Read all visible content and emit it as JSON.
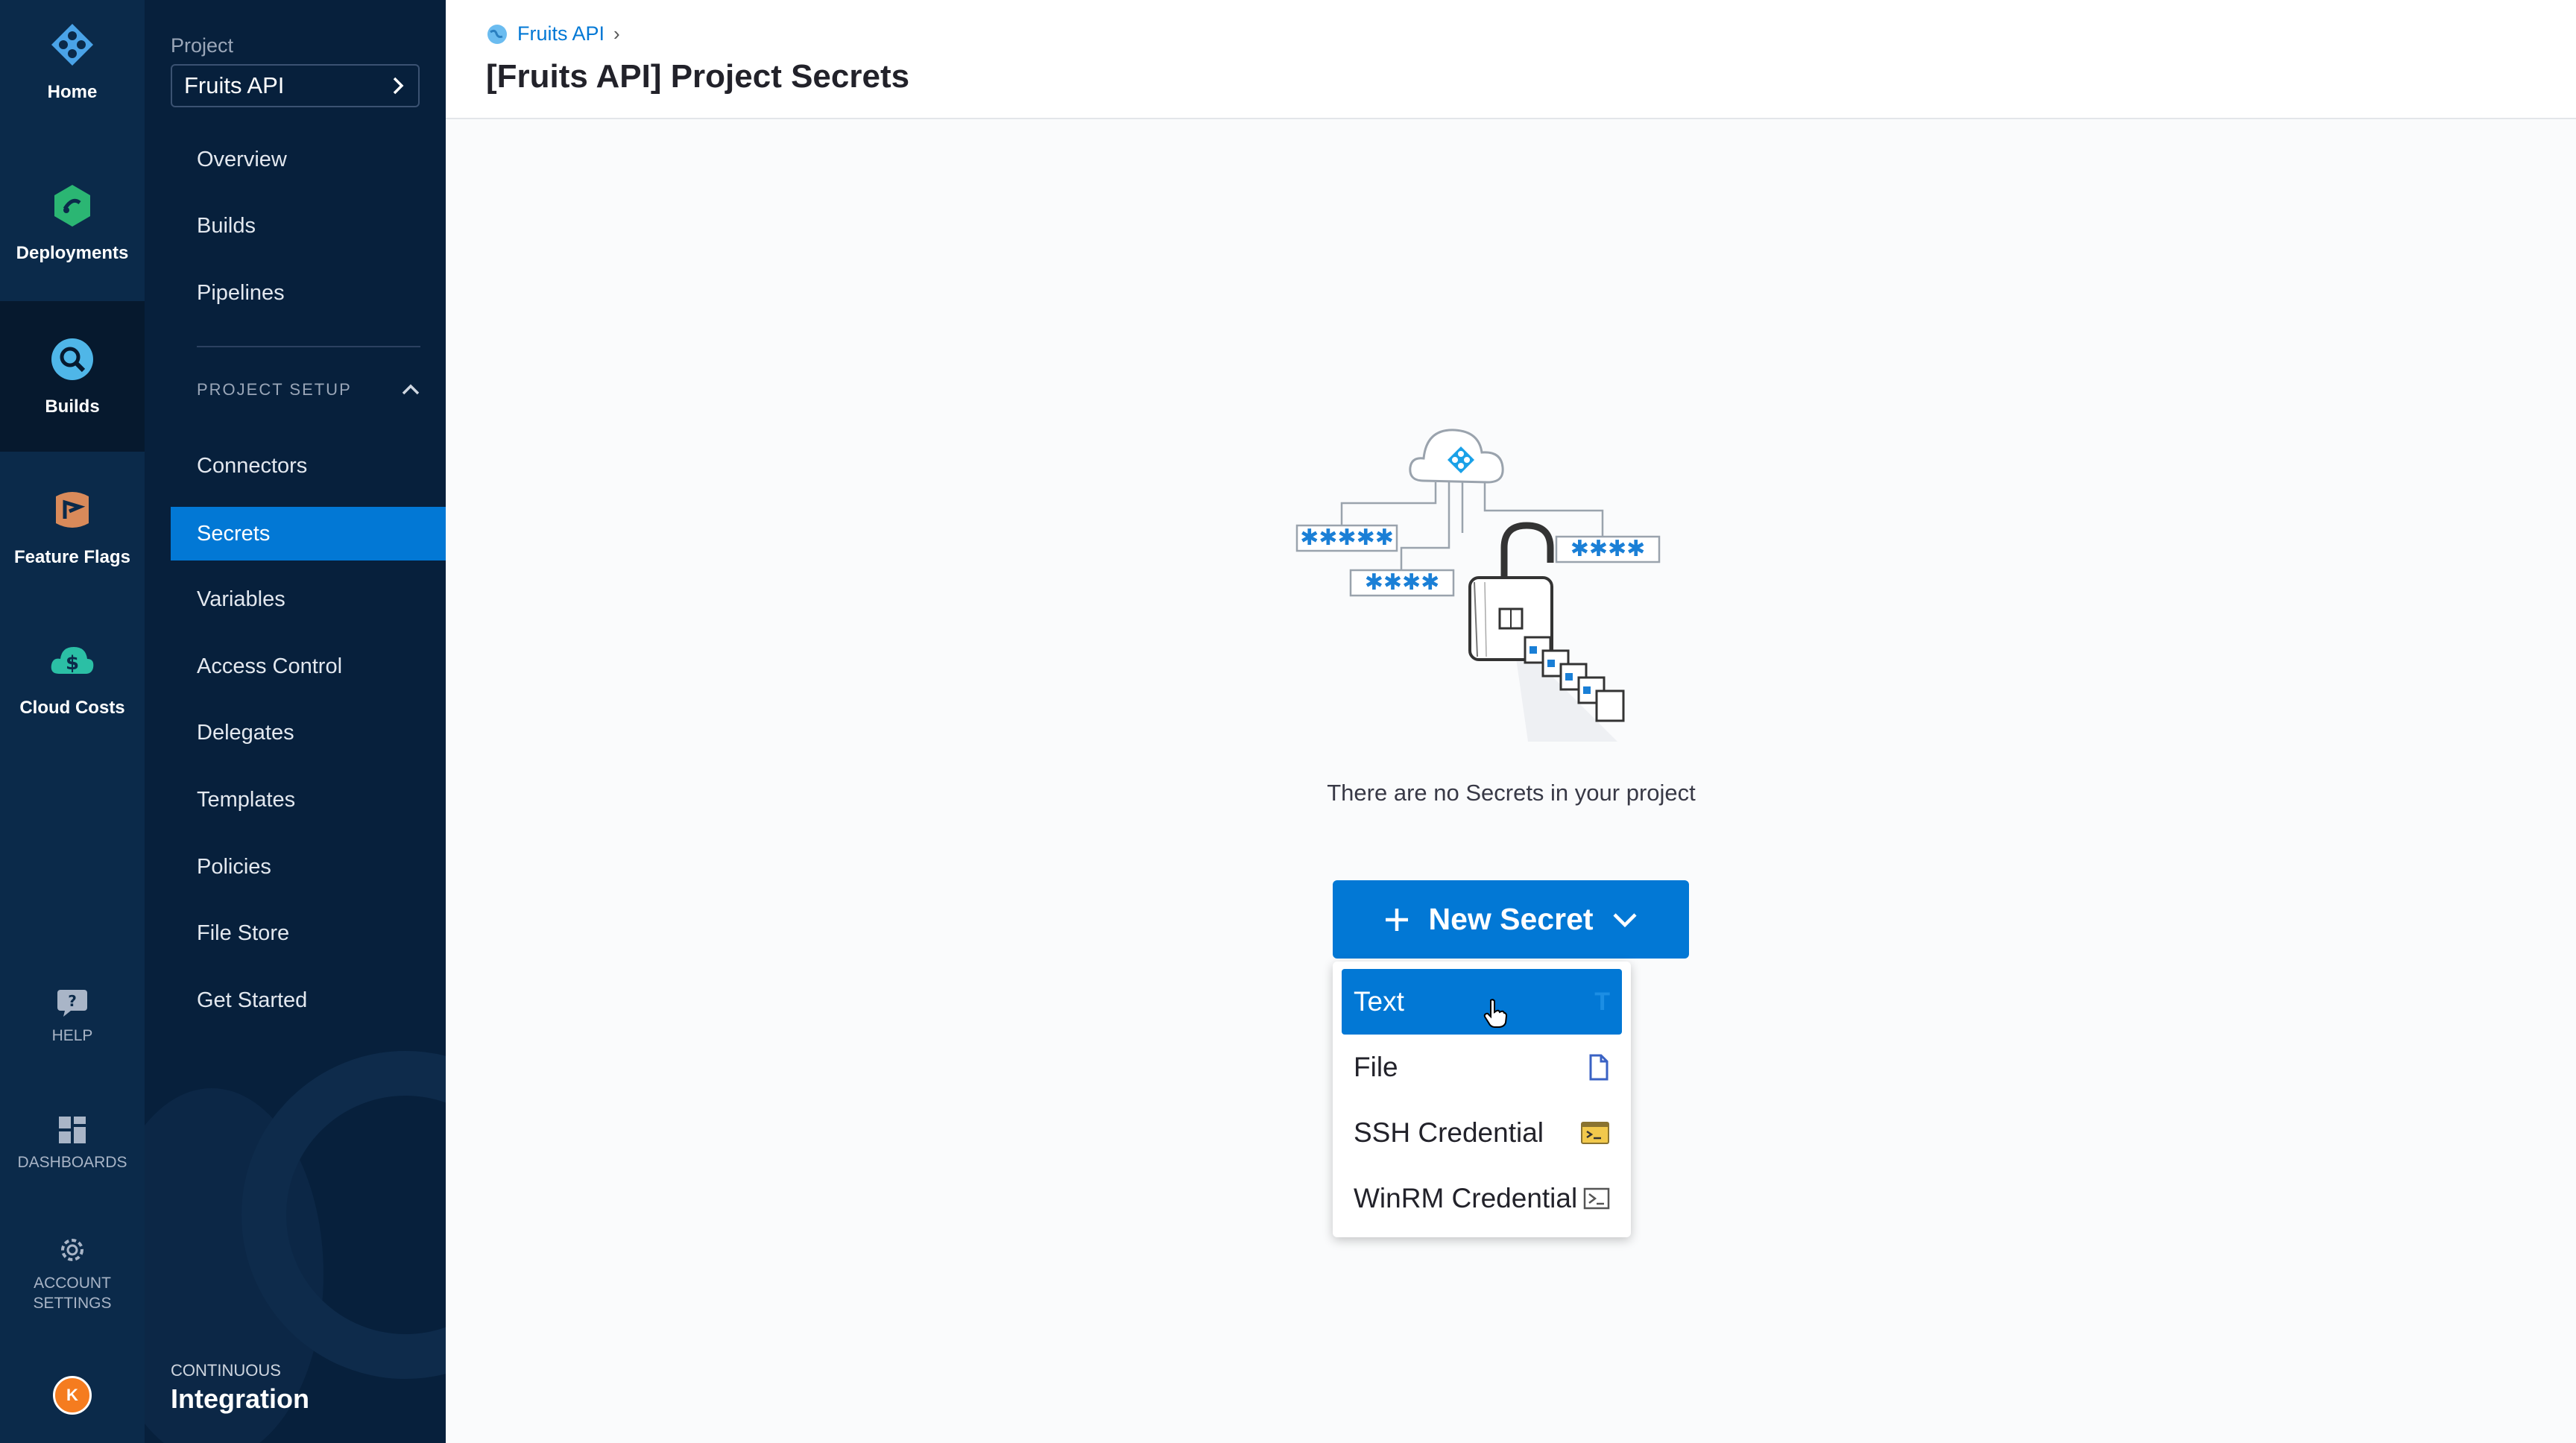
{
  "rail": {
    "items": [
      {
        "label": "Home",
        "icon": "harness-logo-icon"
      },
      {
        "label": "Deployments",
        "icon": "deployments-icon"
      },
      {
        "label": "Builds",
        "icon": "builds-icon",
        "active": true
      },
      {
        "label": "Feature Flags",
        "icon": "feature-flags-icon"
      },
      {
        "label": "Cloud Costs",
        "icon": "cloud-costs-icon"
      }
    ],
    "help": "HELP",
    "dashboards": "DASHBOARDS",
    "account_settings_line1": "ACCOUNT",
    "account_settings_line2": "SETTINGS",
    "avatar_initial": "K"
  },
  "sidebar": {
    "project_label": "Project",
    "project_name": "Fruits API",
    "items": [
      "Overview",
      "Builds",
      "Pipelines"
    ],
    "section_title": "PROJECT SETUP",
    "setup_items": [
      "Connectors",
      "Secrets",
      "Variables",
      "Access Control",
      "Delegates",
      "Templates",
      "Policies",
      "File Store",
      "Get Started"
    ],
    "selected": "Secrets",
    "module_small": "CONTINUOUS",
    "module_big": "Integration"
  },
  "header": {
    "breadcrumb": "Fruits API",
    "title": "[Fruits API] Project Secrets"
  },
  "empty_state": {
    "message": "There are no Secrets in your project",
    "button_label": "New Secret"
  },
  "menu": {
    "items": [
      "Text",
      "File",
      "SSH Credential",
      "WinRM Credential"
    ],
    "highlighted": "Text"
  },
  "colors": {
    "primary": "#0278d5",
    "rail_bg": "#0b2a4a",
    "sidebar_bg": "#07203c"
  }
}
